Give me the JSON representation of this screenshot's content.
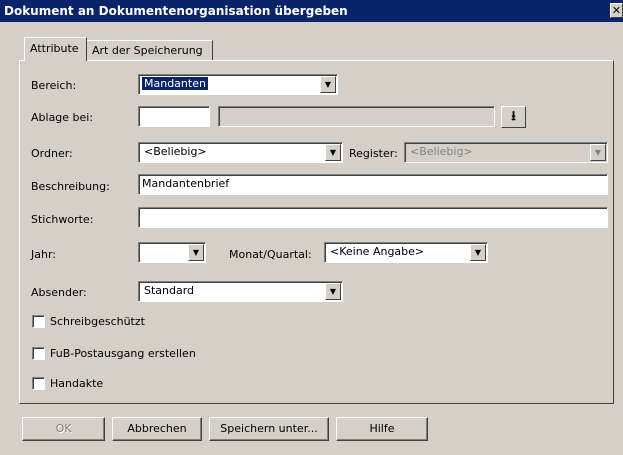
{
  "window": {
    "title": "Dokument an Dokumentenorganisation übergeben",
    "close_glyph": "✕"
  },
  "tabs": [
    {
      "label": "Attribute",
      "active": true
    },
    {
      "label": "Art der Speicherung",
      "active": false
    }
  ],
  "form": {
    "bereich": {
      "label": "Bereich:",
      "value": "Mandanten"
    },
    "ablage": {
      "label": "Ablage bei:",
      "value1": "",
      "value2": ""
    },
    "ordner": {
      "label": "Ordner:",
      "value": "<Beliebig>"
    },
    "register": {
      "label": "Register:",
      "value": "<Beliebig>"
    },
    "beschreibung": {
      "label": "Beschreibung:",
      "value": "Mandantenbrief"
    },
    "stichworte": {
      "label": "Stichworte:",
      "value": ""
    },
    "jahr": {
      "label": "Jahr:",
      "value": ""
    },
    "monat": {
      "label": "Monat/Quartal:",
      "value": "<Keine Angabe>"
    },
    "absender": {
      "label": "Absender:",
      "value": "Standard"
    }
  },
  "checkboxes": [
    {
      "label": "Schreibgeschützt",
      "checked": false
    },
    {
      "label": "FuB-Postausgang erstellen",
      "checked": false
    },
    {
      "label": "Handakte",
      "checked": false
    }
  ],
  "buttons": {
    "ok": "OK",
    "cancel": "Abbrechen",
    "save_as": "Speichern unter...",
    "help": "Hilfe"
  },
  "icons": {
    "dropdown": "▼",
    "download": "⭳"
  }
}
